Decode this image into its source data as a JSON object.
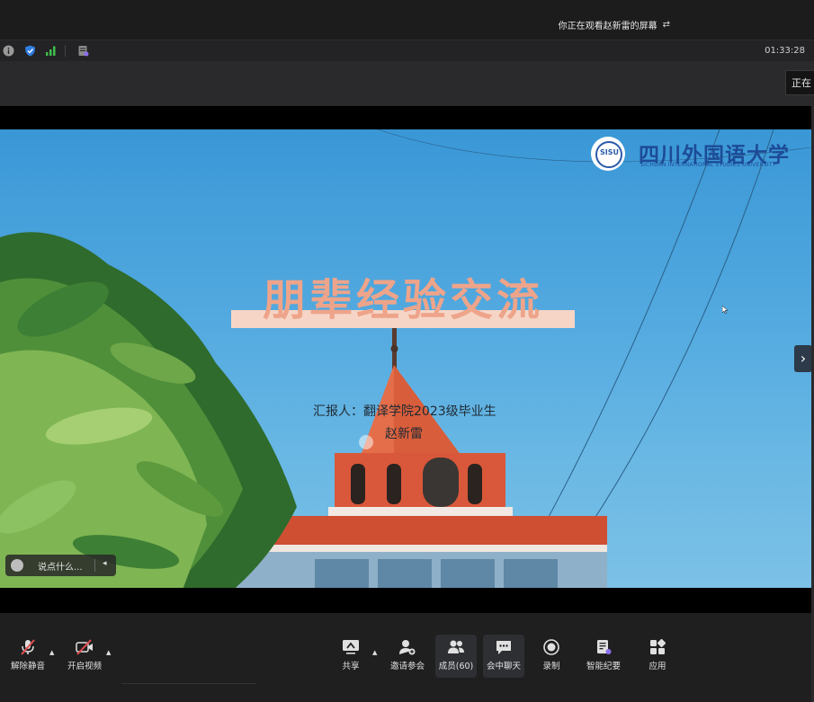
{
  "topbar": {
    "share_notice": "你正在观看赵新雷的屏幕",
    "switch_icon": "swap-icon"
  },
  "infobar": {
    "icons": [
      "info-icon",
      "shield-icon",
      "signal-icon",
      "notes-icon"
    ],
    "timer": "01:33:28",
    "status_chip": "正在"
  },
  "slide": {
    "title": "朋辈经验交流",
    "reporter": "汇报人：翻译学院2023级毕业生",
    "reporter_name": "赵新雷",
    "university_cn": "四川外国语大学",
    "university_en": "SICHUAN INTERNATIONAL STUDIES UNIVERSITY",
    "logo_text": "SISU"
  },
  "chat": {
    "placeholder": "说点什么..."
  },
  "toolbar": {
    "mute": "解除静音",
    "video": "开启视频",
    "share": "共享",
    "invite": "邀请参会",
    "members": "成员(60)",
    "chat": "会中聊天",
    "record": "录制",
    "notes": "智能纪要",
    "apps": "应用"
  },
  "colors": {
    "title": "#eea48a",
    "title_bar": "#f6d5c6",
    "university_blue": "#1d4b96",
    "mute_red": "#e34d4d",
    "sky": "#4aa3dc",
    "tower": "#d9573a"
  }
}
